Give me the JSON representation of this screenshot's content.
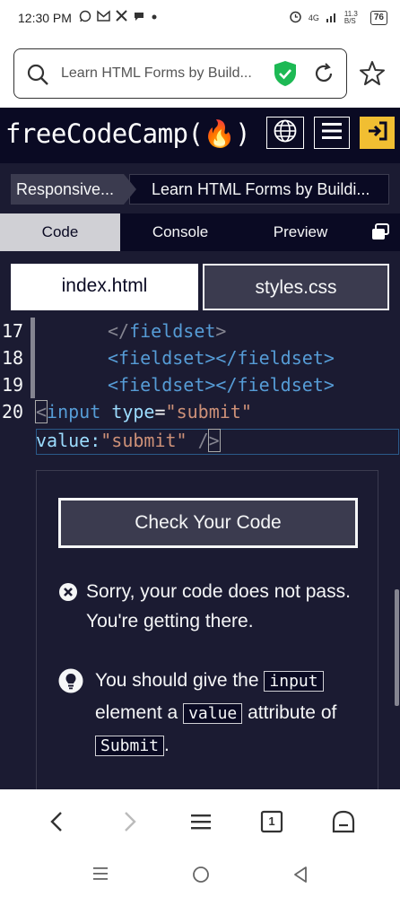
{
  "status_bar": {
    "time": "12:30 PM",
    "network": "4G",
    "speed": "11.3 B/S",
    "battery": "76"
  },
  "browser": {
    "url_text": "Learn HTML Forms by Build..."
  },
  "fcc": {
    "logo": "freeCodeCamp(🔥)"
  },
  "breadcrumb": {
    "superblock": "Responsive...",
    "block": "Learn HTML Forms by Buildi..."
  },
  "tabs": {
    "code": "Code",
    "console": "Console",
    "preview": "Preview"
  },
  "files": {
    "index": "index.html",
    "styles": "styles.css"
  },
  "editor": {
    "line_numbers": [
      "17",
      "18",
      "19",
      "20"
    ],
    "lines": [
      {
        "tag_open": "</",
        "tag": "fieldset",
        "tag_close": ">"
      },
      {
        "text": "<fieldset></fieldset>"
      },
      {
        "text": "<fieldset></fieldset>"
      }
    ],
    "line20_part1": {
      "open": "<",
      "tag": "input",
      "attr": "type",
      "eq": "=",
      "val": "\"submit\""
    },
    "line20_part2": {
      "attr": "value:",
      "val": "\"submit\"",
      "close_slash": " /",
      "close": ">"
    }
  },
  "feedback": {
    "check_button": "Check Your Code",
    "fail_message": "Sorry, your code does not pass. You're getting there.",
    "hint_prefix": "You should give the",
    "hint_code1": "input",
    "hint_mid1": "element a",
    "hint_code2": "value",
    "hint_mid2": "attribute of",
    "hint_code3": "Submit",
    "hint_suffix": "."
  },
  "toolbar": {
    "tab_count": "1"
  }
}
